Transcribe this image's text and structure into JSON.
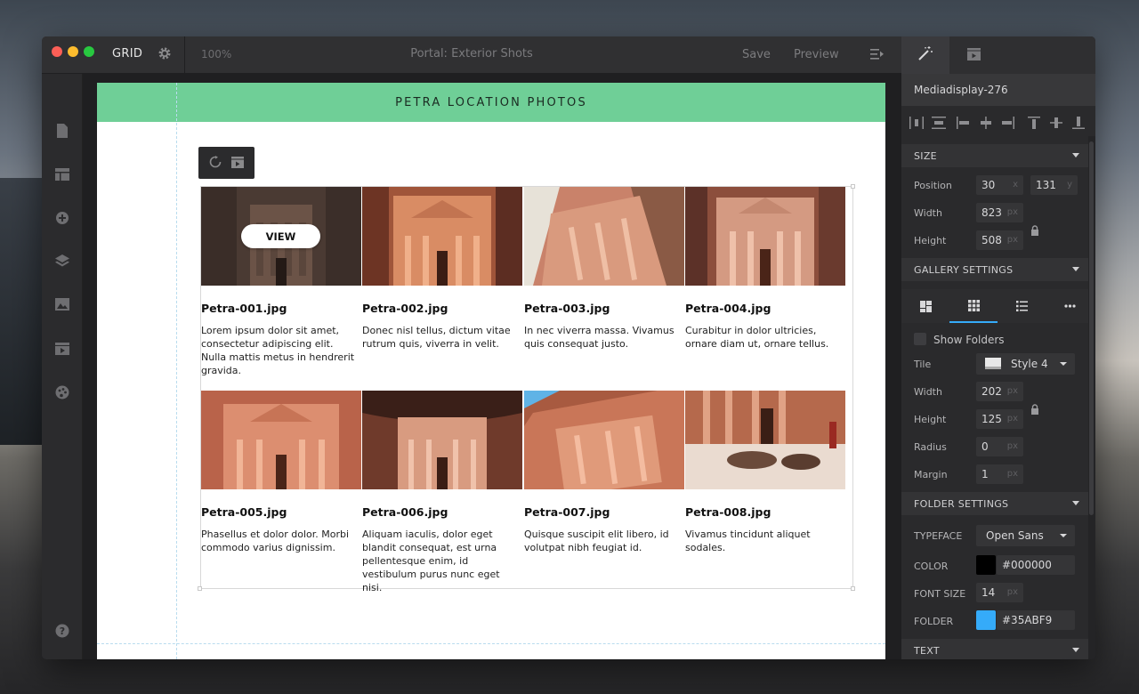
{
  "app": {
    "name": "GRID",
    "zoom": "100%",
    "document_title": "Portal: Exterior Shots",
    "save_label": "Save",
    "preview_label": "Preview"
  },
  "page": {
    "banner_title": "PETRA LOCATION PHOTOS",
    "view_label": "VIEW",
    "tiles": [
      {
        "title": "Petra-001.jpg",
        "desc": "Lorem ipsum dolor sit amet, consectetur adipiscing elit. Nulla mattis metus in hendrerit gravida."
      },
      {
        "title": "Petra-002.jpg",
        "desc": "Donec nisl tellus, dictum vitae rutrum quis, viverra in velit."
      },
      {
        "title": "Petra-003.jpg",
        "desc": "In nec viverra massa. Vivamus quis consequat justo."
      },
      {
        "title": "Petra-004.jpg",
        "desc": "Curabitur in dolor ultricies, ornare diam ut, ornare tellus."
      },
      {
        "title": "Petra-005.jpg",
        "desc": "Phasellus et dolor dolor. Morbi commodo varius dignissim."
      },
      {
        "title": "Petra-006.jpg",
        "desc": "Aliquam iaculis, dolor eget blandit consequat, est urna pellentesque enim, id vestibulum purus nunc eget nisi."
      },
      {
        "title": "Petra-007.jpg",
        "desc": "Quisque suscipit elit libero, id volutpat nibh feugiat id."
      },
      {
        "title": "Petra-008.jpg",
        "desc": "Vivamus tincidunt aliquet sodales."
      }
    ]
  },
  "panel": {
    "element_name": "Mediadisplay-276",
    "size": {
      "header": "SIZE",
      "position_label": "Position",
      "position_x": "30",
      "position_x_unit": "x",
      "position_y": "131",
      "position_y_unit": "y",
      "width_label": "Width",
      "width_value": "823",
      "height_label": "Height",
      "height_value": "508",
      "unit": "px"
    },
    "gallery": {
      "header": "GALLERY SETTINGS",
      "show_folders_label": "Show Folders",
      "tile_label": "Tile",
      "tile_style": "Style 4",
      "width_label": "Width",
      "width_value": "202",
      "height_label": "Height",
      "height_value": "125",
      "radius_label": "Radius",
      "radius_value": "0",
      "margin_label": "Margin",
      "margin_value": "1",
      "unit": "px"
    },
    "folder": {
      "header": "FOLDER SETTINGS",
      "typeface_label": "TYPEFACE",
      "typeface_value": "Open Sans",
      "color_label": "COLOR",
      "color_value": "#000000",
      "font_size_label": "FONT SIZE",
      "font_size_value": "14",
      "folder_label": "FOLDER",
      "folder_value": "#35ABF9",
      "unit": "px"
    },
    "text": {
      "header": "TEXT"
    }
  },
  "colors": {
    "banner": "#6fcf97",
    "accent": "#35abf9",
    "color_swatch": "#000000",
    "folder_swatch": "#35ABF9"
  }
}
